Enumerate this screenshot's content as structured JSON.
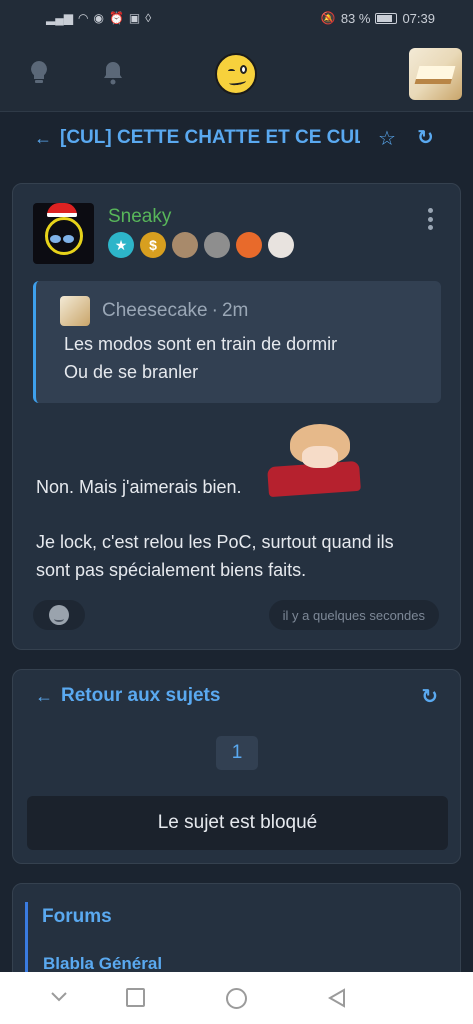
{
  "status_bar": {
    "signal_icon": "signal-icon",
    "battery_percent": "83 %",
    "battery_level": 0.83,
    "time": "07:39"
  },
  "app_header": {
    "icons": [
      "lightbulb-icon",
      "bell-icon",
      "smiley-logo-icon",
      "user-avatar"
    ]
  },
  "topic": {
    "title": "[CUL] CETTE CHATTE ET CE CUL"
  },
  "post": {
    "username": "Sneaky",
    "username_color": "#58b65a",
    "badges": [
      "star-badge",
      "dollar-badge",
      "avatar-badge",
      "avatar-badge",
      "emoji-badge",
      "avatar-badge"
    ],
    "badge_labels": {
      "star": "★",
      "dollar": "$"
    },
    "quote": {
      "author": "Cheesecake",
      "separator": "·",
      "time": "2m",
      "lines": [
        "Les modos sont en train de dormir",
        "Ou de se branler"
      ]
    },
    "body": [
      "Non. Mais j'aimerais bien.",
      "Je lock, c'est relou les PoC, surtout quand ils",
      "sont pas spécialement biens faits."
    ],
    "timestamp": "il y a quelques secondes"
  },
  "navigation": {
    "back_label": "Retour aux sujets",
    "current_page": "1",
    "locked_message": "Le sujet est bloqué"
  },
  "forums": {
    "title": "Forums",
    "items": [
      "Blabla Général"
    ]
  },
  "colors": {
    "accent": "#5aa9f0",
    "background": "#1b2430",
    "card": "#253140"
  }
}
